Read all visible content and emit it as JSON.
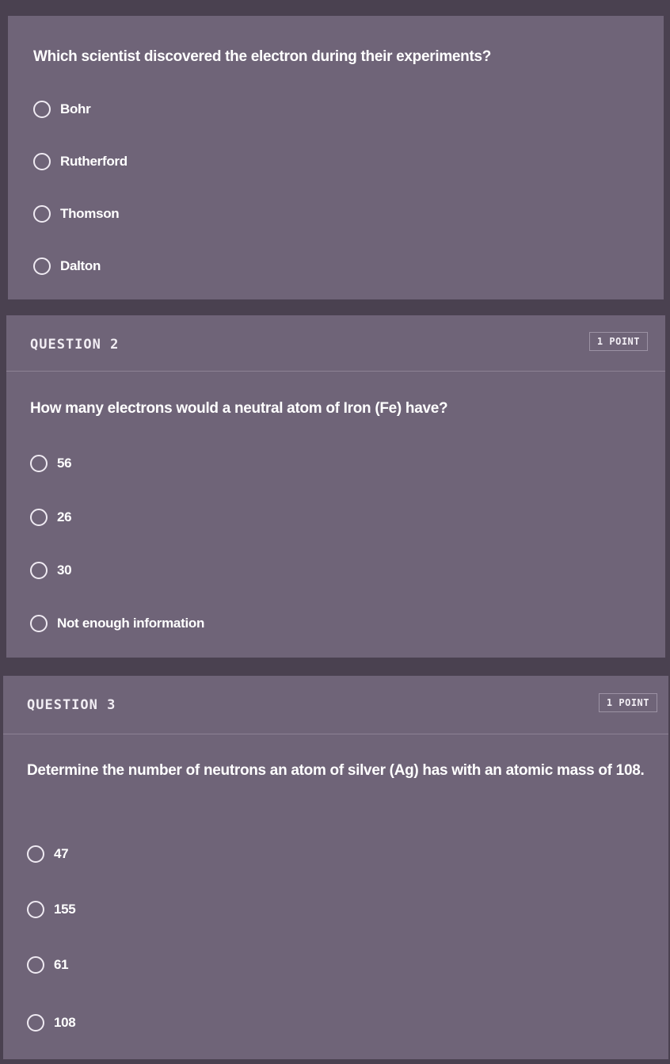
{
  "questions": [
    {
      "label": "",
      "points": "",
      "text": "Which scientist discovered the electron during their experiments?",
      "options": [
        "Bohr",
        "Rutherford",
        "Thomson",
        "Dalton"
      ]
    },
    {
      "label": "QUESTION 2",
      "points": "1 POINT",
      "text": "How many electrons would a neutral atom of Iron (Fe) have?",
      "options": [
        "56",
        "26",
        "30",
        "Not enough information"
      ]
    },
    {
      "label": "QUESTION 3",
      "points": "1 POINT",
      "text": "Determine the number of neutrons an atom of silver (Ag) has with an atomic mass of 108.",
      "options": [
        "47",
        "155",
        "61",
        "108"
      ]
    }
  ]
}
